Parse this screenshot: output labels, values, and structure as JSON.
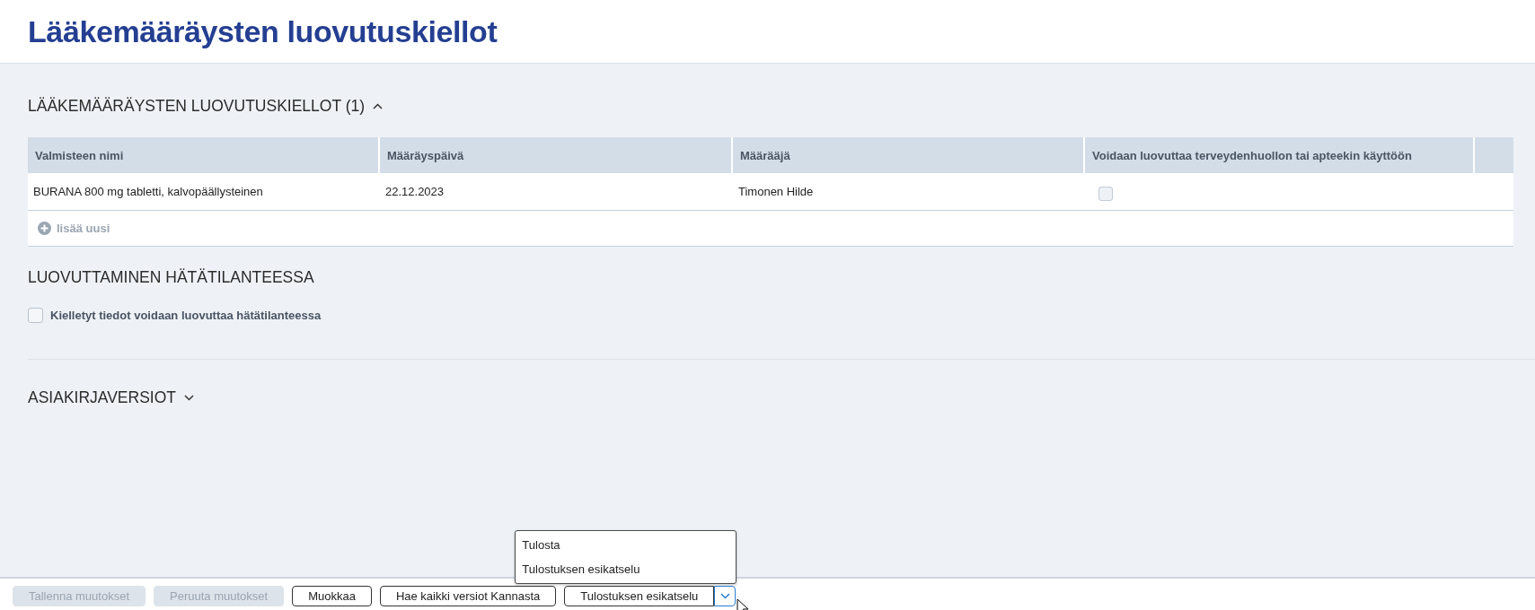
{
  "page": {
    "title": "Lääkemääräysten luovutuskiellot"
  },
  "prohibitions_section": {
    "title": "LÄÄKEMÄÄRÄYSTEN LUOVUTUSKIELLOT (1)",
    "expanded": true,
    "table": {
      "columns": [
        "Valmisteen nimi",
        "Määräyspäivä",
        "Määrääjä",
        "Voidaan luovuttaa terveydenhuollon tai apteekin käyttöön"
      ],
      "rows": [
        {
          "cells": [
            "BURANA 800 mg tabletti, kalvopäällysteinen",
            "22.12.2023",
            "Timonen Hilde"
          ],
          "checked": false
        }
      ],
      "add_link": "lisää uusi"
    }
  },
  "emergency_section": {
    "title": "LUOVUTTAMINEN HÄTÄTILANTEESSA",
    "checkbox": {
      "label": "Kielletyt tiedot voidaan luovuttaa hätätilanteessa",
      "checked": false
    }
  },
  "versions_section": {
    "title": "ASIAKIRJAVERSIOT",
    "expanded": false
  },
  "toolbar": {
    "buttons": [
      {
        "label": "Tallenna muutokset",
        "disabled": true
      },
      {
        "label": "Peruuta muutokset",
        "disabled": true
      },
      {
        "label": "Muokkaa",
        "disabled": false
      },
      {
        "label": "Hae kaikki versiot Kannasta",
        "disabled": false
      }
    ],
    "split_button": {
      "label": "Tulostuksen esikatselu",
      "menu_open": true,
      "menu": [
        "Tulosta",
        "Tulostuksen esikatselu"
      ]
    }
  }
}
